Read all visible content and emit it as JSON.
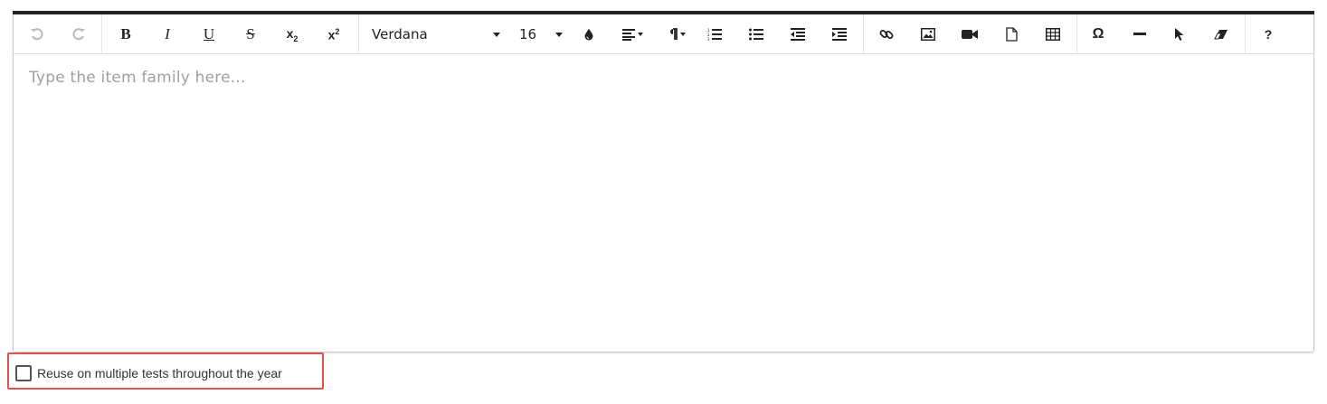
{
  "toolbar": {
    "font_family": "Verdana",
    "font_size": "16",
    "special_char": "Ω",
    "help": "?",
    "subscript_base": "x",
    "subscript_mark": "2",
    "superscript_base": "x",
    "superscript_mark": "2",
    "bold": "B",
    "italic": "I",
    "underline": "U",
    "strike": "S"
  },
  "editor": {
    "placeholder": "Type the item family here..."
  },
  "options": {
    "reuse_label": "Reuse on multiple tests throughout the year",
    "reuse_checked": false
  },
  "colors": {
    "highlight_border": "#e05252",
    "toolbar_top_bar": "#222222",
    "disabled_icon": "#b8b8b8"
  }
}
